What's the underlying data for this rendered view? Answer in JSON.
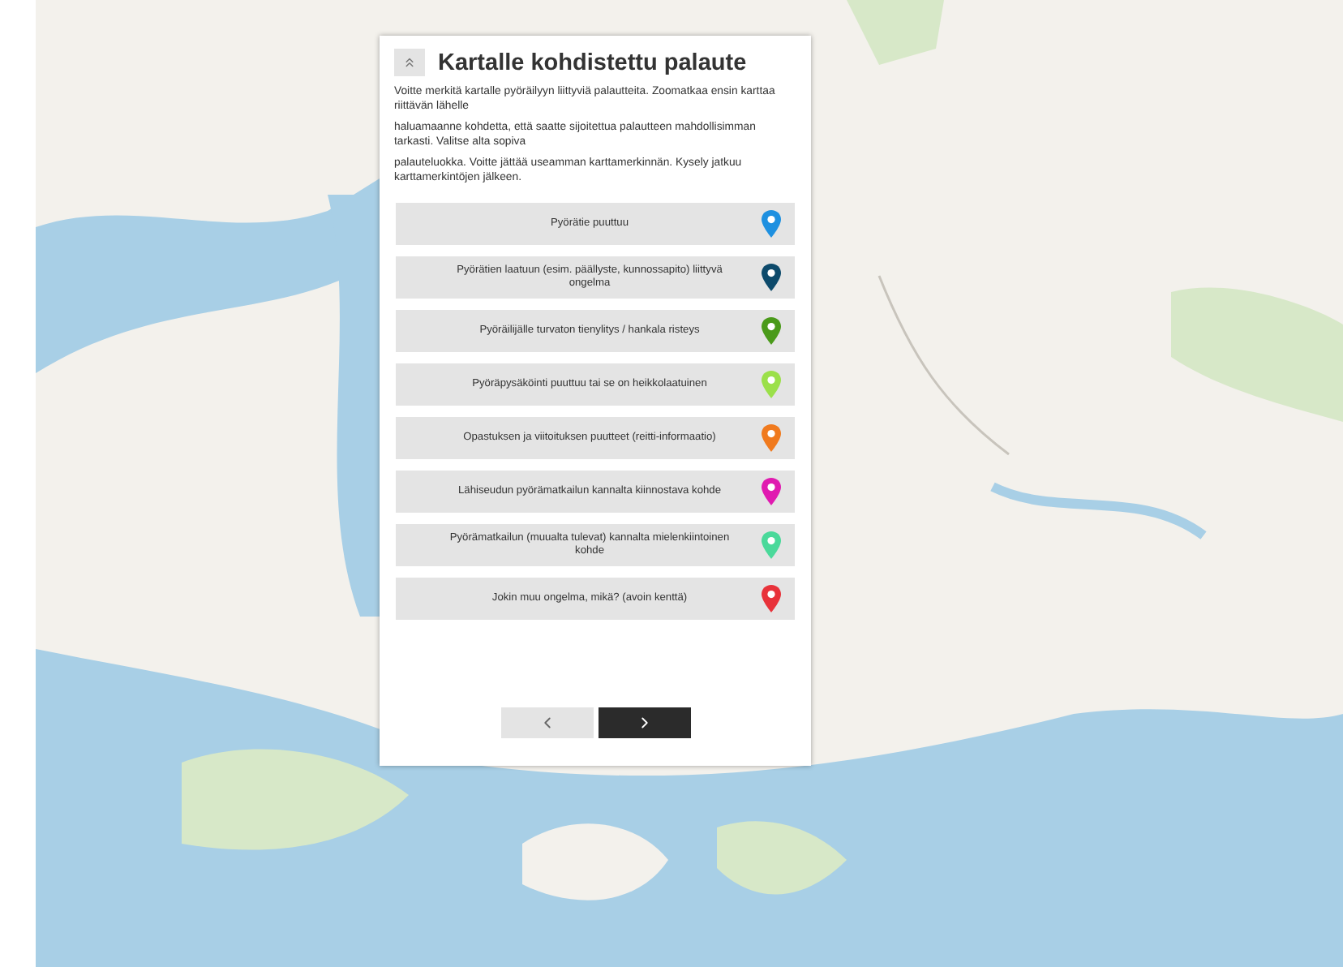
{
  "panel": {
    "title": "Kartalle kohdistettu palaute",
    "paragraphs": [
      "Voitte merkitä kartalle pyöräilyyn liittyviä palautteita. Zoomatkaa ensin karttaa riittävän lähelle",
      "haluamaanne kohdetta, että saatte sijoitettua palautteen mahdollisimman tarkasti. Valitse alta sopiva",
      "palauteluokka. Voitte jättää useamman karttamerkinnän. Kysely jatkuu karttamerkintöjen jälkeen."
    ],
    "categories": [
      {
        "label": "Pyörätie puuttuu",
        "color": "#1e90e0"
      },
      {
        "label": "Pyörätien laatuun (esim. päällyste, kunnossapito) liittyvä ongelma",
        "color": "#0d4a6b"
      },
      {
        "label": "Pyöräilijälle turvaton tienylitys / hankala risteys",
        "color": "#4a9a1a"
      },
      {
        "label": "Pyöräpysäköinti puuttuu tai se on heikkolaatuinen",
        "color": "#9be04a"
      },
      {
        "label": "Opastuksen ja viitoituksen puutteet (reitti-informaatio)",
        "color": "#f07a1e"
      },
      {
        "label": "Lähiseudun pyörämatkailun kannalta kiinnostava kohde",
        "color": "#e01ab0"
      },
      {
        "label": "Pyörämatkailun (muualta tulevat) kannalta mielenkiintoinen kohde",
        "color": "#4ad99a"
      },
      {
        "label": "Jokin muu ongelma, mikä? (avoin kenttä)",
        "color": "#e8323a"
      }
    ],
    "nav": [
      {
        "kind": "prev",
        "disabled": true
      },
      {
        "kind": "next",
        "disabled": false
      }
    ]
  }
}
